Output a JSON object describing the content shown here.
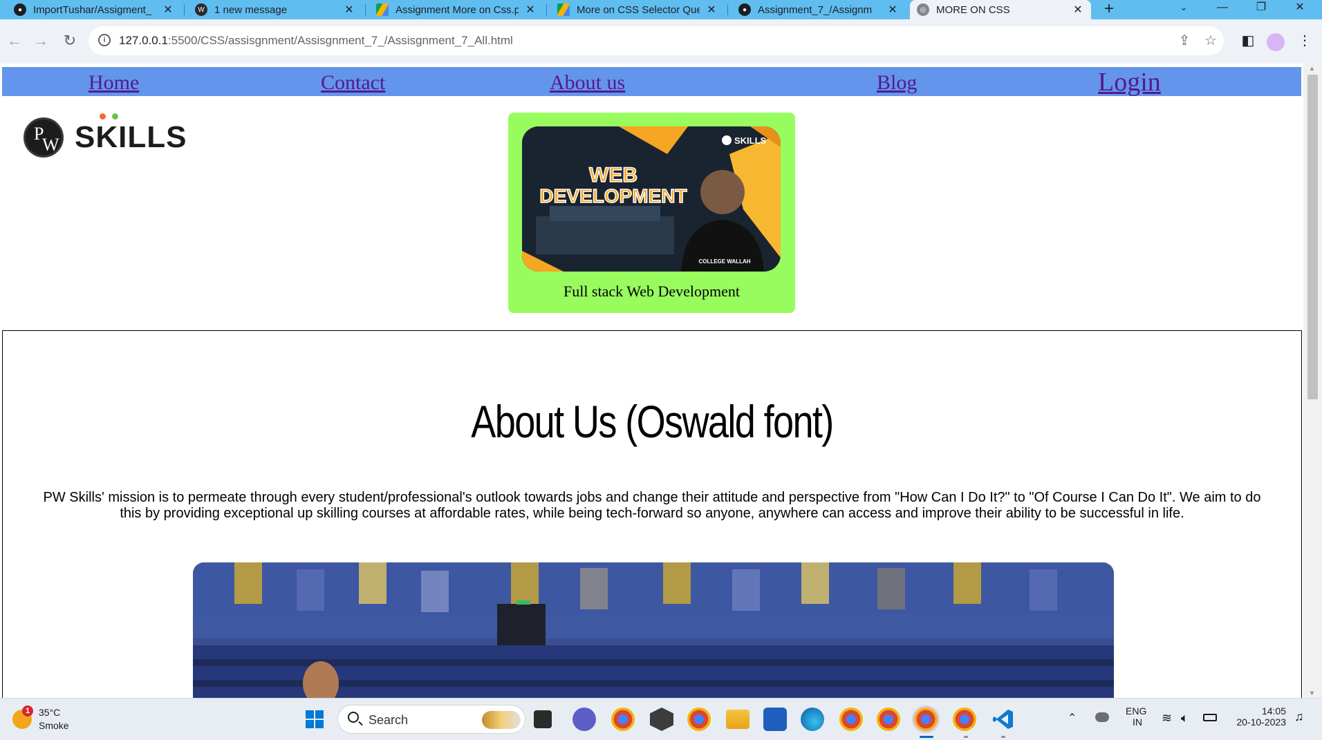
{
  "browser": {
    "tabs": [
      {
        "title": "ImportTushar/Assigment_",
        "icon": "github-icon",
        "active": false
      },
      {
        "title": "1 new message",
        "icon": "wordpress-icon",
        "active": false
      },
      {
        "title": "Assignment More on Css.p",
        "icon": "google-drive-icon",
        "active": false
      },
      {
        "title": "More on CSS Selector Que",
        "icon": "google-drive-icon",
        "active": false
      },
      {
        "title": "Assignment_7_/Assignm",
        "icon": "github-icon",
        "active": false
      },
      {
        "title": "MORE ON CSS",
        "icon": "globe-icon",
        "active": true
      }
    ],
    "new_tab": "+",
    "url_host": "127.0.0.1",
    "url_path": ":5500/CSS/assisgnment/Assisgnment_7_/Assisgnment_7_All.html"
  },
  "page": {
    "nav": {
      "home": "Home",
      "contact": "Contact",
      "about": "About us",
      "blog": "Blog",
      "login": "Login"
    },
    "logo": {
      "initials_p": "P",
      "initials_w": "W",
      "wordmark": "SKILLS"
    },
    "card": {
      "image_title_line1": "WEB",
      "image_title_line2": "DEVELOPMENT",
      "image_brand": "SKILLS",
      "image_shirt": "COLLEGE WALLAH",
      "caption": "Full stack Web Development"
    },
    "about": {
      "heading": "About Us (Oswald font)",
      "text": "PW Skills' mission is to permeate through every student/professional's outlook towards jobs and change their attitude and perspective from \"How Can I Do It?\" to \"Of Course I Can Do It\". We aim to do this by providing exceptional up skilling courses at affordable rates, while being tech-forward so anyone, anywhere can access and improve their ability to be successful in life."
    }
  },
  "taskbar": {
    "weather_badge": "1",
    "temperature": "35°C",
    "condition": "Smoke",
    "search_placeholder": "Search",
    "lang_top": "ENG",
    "lang_bottom": "IN",
    "time": "14:05",
    "date": "20-10-2023"
  },
  "colors": {
    "tabstrip": "#5fbdf0",
    "nav_bar": "#6495ed",
    "card_bg": "#98fb5e",
    "link_visited": "#551a8b"
  }
}
